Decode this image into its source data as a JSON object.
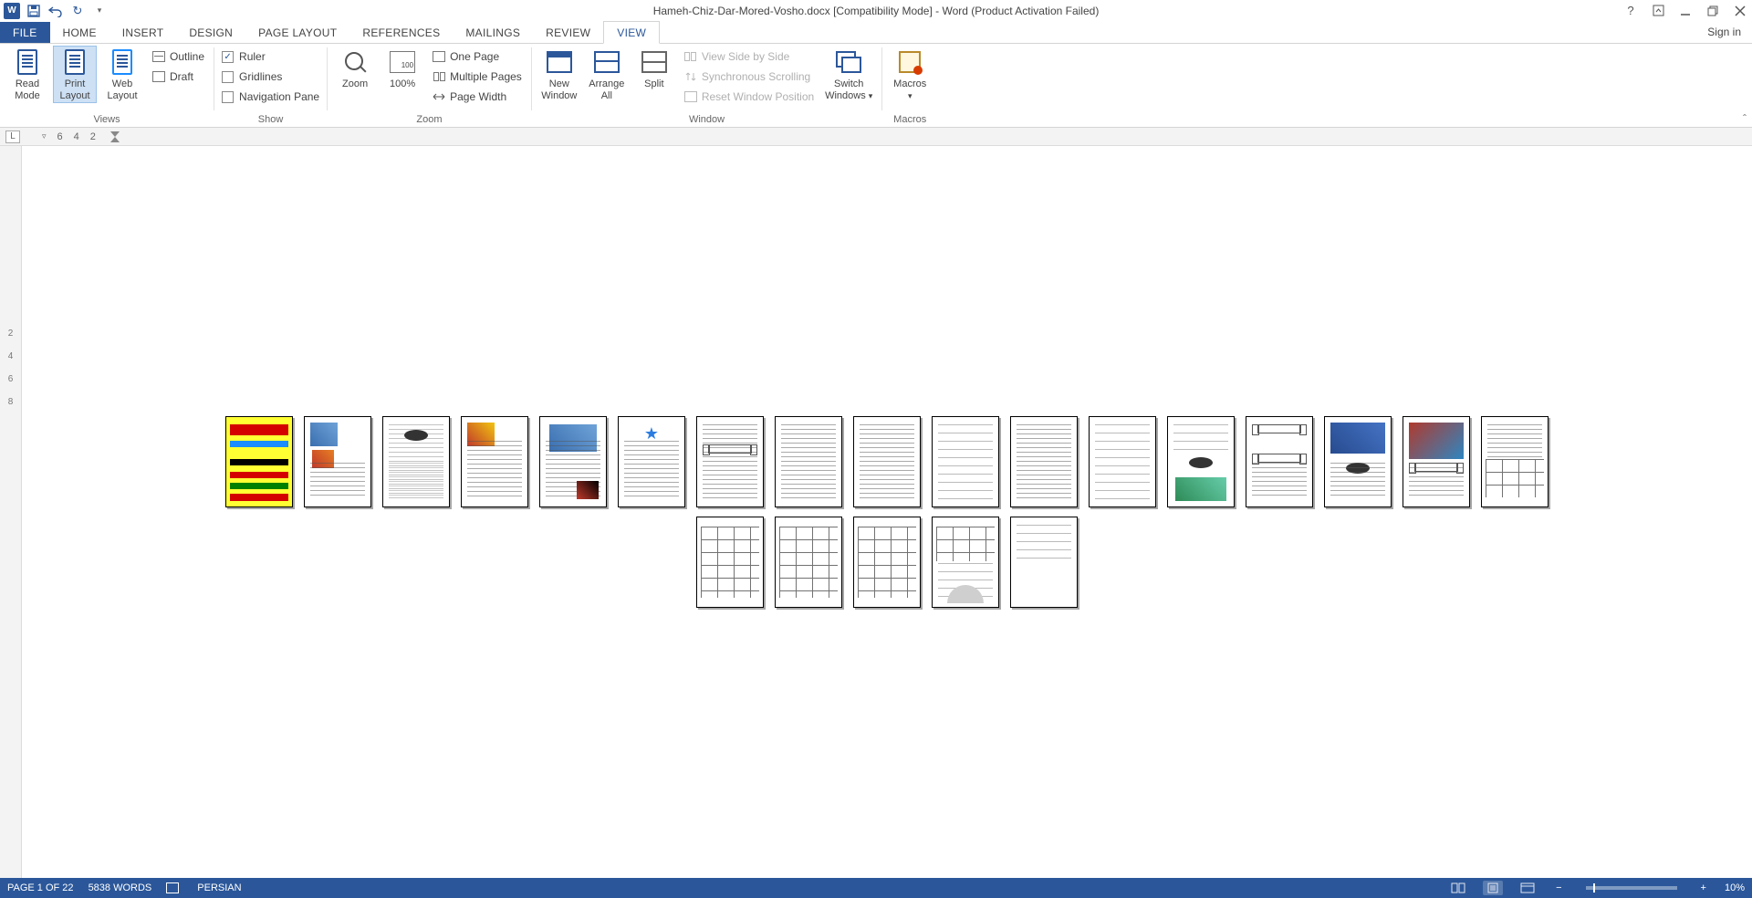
{
  "titlebar": {
    "title": "Hameh-Chiz-Dar-Mored-Vosho.docx [Compatibility Mode] - Word (Product Activation Failed)"
  },
  "tabs": {
    "file": "FILE",
    "items": [
      "HOME",
      "INSERT",
      "DESIGN",
      "PAGE LAYOUT",
      "REFERENCES",
      "MAILINGS",
      "REVIEW",
      "VIEW"
    ],
    "active": "VIEW",
    "signin": "Sign in"
  },
  "ribbon": {
    "views": {
      "label": "Views",
      "read_mode": "Read\nMode",
      "print_layout": "Print\nLayout",
      "web_layout": "Web\nLayout",
      "outline": "Outline",
      "draft": "Draft"
    },
    "show": {
      "label": "Show",
      "ruler": "Ruler",
      "gridlines": "Gridlines",
      "nav": "Navigation Pane",
      "ruler_checked": true,
      "gridlines_checked": false,
      "nav_checked": false
    },
    "zoom": {
      "label": "Zoom",
      "zoom_btn": "Zoom",
      "hundred": "100%",
      "one_page": "One Page",
      "multi": "Multiple Pages",
      "page_width": "Page Width"
    },
    "window": {
      "label": "Window",
      "new_window": "New\nWindow",
      "arrange": "Arrange\nAll",
      "split": "Split",
      "side": "View Side by Side",
      "sync": "Synchronous Scrolling",
      "reset": "Reset Window Position",
      "switch": "Switch\nWindows"
    },
    "macros": {
      "label": "Macros",
      "btn": "Macros"
    }
  },
  "ruler": {
    "tab_stop": "L",
    "numbers": [
      "6",
      "4",
      "2"
    ]
  },
  "vruler": [
    "2",
    "4",
    "6",
    "8"
  ],
  "status": {
    "page": "PAGE 1 OF 22",
    "words": "5838 WORDS",
    "lang": "PERSIAN",
    "zoom": "10%"
  }
}
